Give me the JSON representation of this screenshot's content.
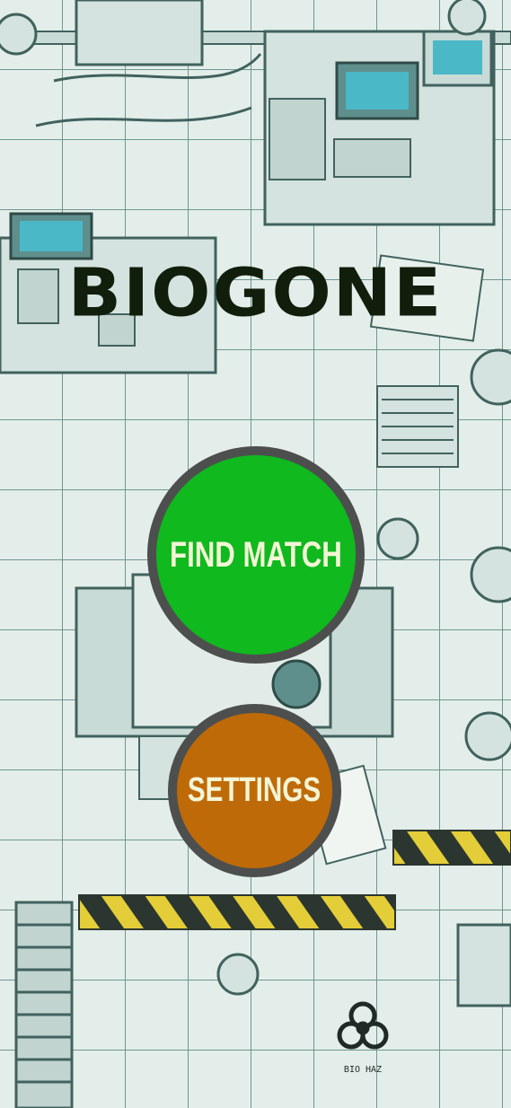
{
  "game": {
    "title": "BIOGONE",
    "find_match_label": "FIND MATCH",
    "settings_label": "SETTINGS",
    "background_sign": "BIO HAZ"
  },
  "colors": {
    "find_match": "#0fb91e",
    "settings": "#bf6a08",
    "button_border": "#4d4f4e",
    "title": "#111e0c",
    "label": "#f3f5d6"
  }
}
